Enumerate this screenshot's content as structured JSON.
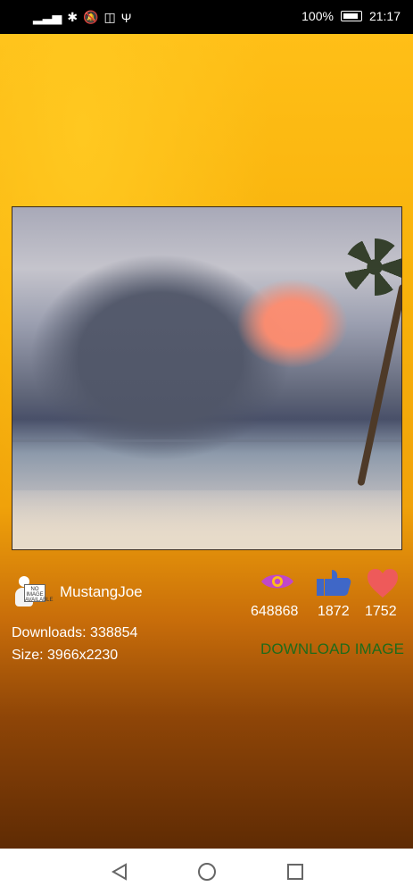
{
  "status_bar": {
    "battery_percent": "100%",
    "time": "21:17"
  },
  "image_card": {
    "username": "MustangJoe",
    "views": "648868",
    "likes": "1872",
    "favorites": "1752",
    "downloads_text": "Downloads: 338854",
    "size_text": "Size: 3966x2230",
    "download_button_label": "DOWNLOAD IMAGE",
    "avatar_sign_text": "NO IMAGE AVAILABLE"
  },
  "colors": {
    "eye_icon": "#c048c8",
    "like_icon": "#3f67c7",
    "heart_icon": "#ee5a5a",
    "download_text": "#1f6b1a"
  },
  "icons": {
    "views": "eye-icon",
    "likes": "thumbs-up-icon",
    "favorites": "heart-icon"
  }
}
